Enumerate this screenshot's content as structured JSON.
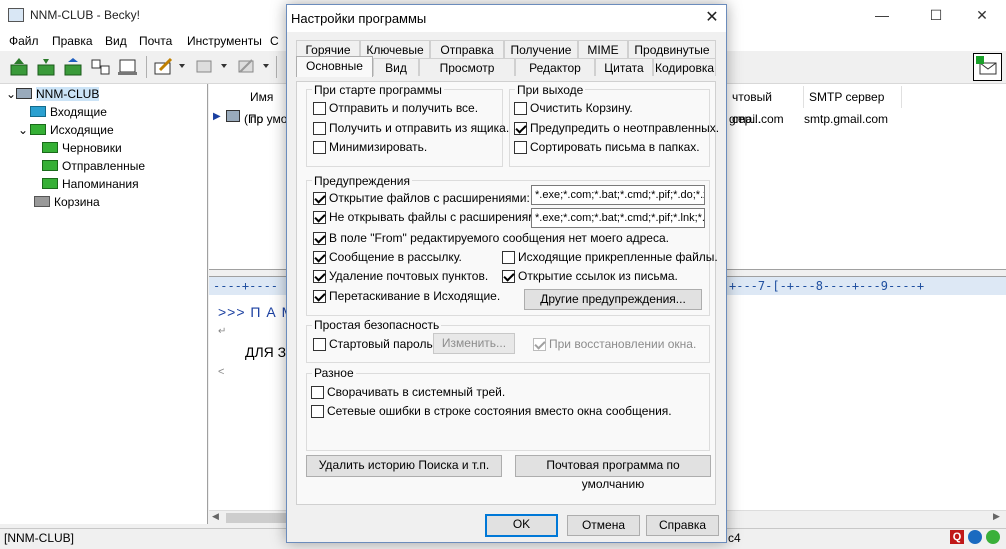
{
  "main_window": {
    "title": "NNM-CLUB - Becky!",
    "menu": [
      "Файл",
      "Правка",
      "Вид",
      "Почта",
      "Инструменты",
      "С"
    ],
    "tree": [
      {
        "label": "NNM-CLUB"
      },
      {
        "label": "Входящие"
      },
      {
        "label": "Исходящие"
      },
      {
        "label": "Черновики"
      },
      {
        "label": "Отправленные"
      },
      {
        "label": "Напоминания"
      },
      {
        "label": "Корзина"
      }
    ],
    "columns": {
      "name": "Имя пр",
      "pop": "чтовый сер...",
      "smtp": "SMTP сервер"
    },
    "row": {
      "name": "(По умо",
      "pop": "gmail.com",
      "smtp": "smtp.gmail.com"
    },
    "ruler_left": "----+----",
    "ruler_right": "+---7-[-+---8----+---9----+",
    "preview": {
      "line1": ">>> П А М",
      "line2": "↵",
      "line3": "ДЛЯ З",
      "line4": "<"
    },
    "status_left": "[NNM-CLUB]",
    "status_right": "c4"
  },
  "dialog": {
    "title": "Настройки программы",
    "tabs_row1": [
      "Горячие",
      "Ключевые",
      "Отправка",
      "Получение",
      "MIME",
      "Продвинутые"
    ],
    "tabs_row2": [
      "Основные",
      "Вид",
      "Просмотр",
      "Редактор",
      "Цитата",
      "Кодировка"
    ],
    "startup": {
      "label": "При старте программы",
      "items": [
        {
          "label": "Отправить и получить все.",
          "checked": false
        },
        {
          "label": "Получить и отправить из ящика.",
          "checked": false
        },
        {
          "label": "Минимизировать.",
          "checked": false
        }
      ]
    },
    "exit": {
      "label": "При выходе",
      "items": [
        {
          "label": "Очистить Корзину.",
          "checked": false
        },
        {
          "label": "Предупредить о неотправленных.",
          "checked": true
        },
        {
          "label": "Сортировать письма в папках.",
          "checked": false
        }
      ]
    },
    "warnings": {
      "label": "Предупреждения",
      "open_ext_label": "Открытие файлов с расширениями:",
      "open_ext_value": "*.exe;*.com;*.bat;*.cmd;*.pif;*.do;*.x",
      "noopen_ext_label": "Не открывать файлы с расширениями:",
      "noopen_ext_value": "*.exe;*.com;*.bat;*.cmd;*.pif;*.lnk;*.s",
      "from_label": "В поле \"From\" редактируемого сообщения нет моего адреса.",
      "mailing_label": "Сообщение в рассылку.",
      "outgoing_attach_label": "Исходящие прикрепленные файлы.",
      "delete_label": "Удаление почтовых пунктов.",
      "links_label": "Открытие ссылок из письма.",
      "drag_label": "Перетаскивание в Исходящие.",
      "other_button": "Другие предупреждения..."
    },
    "security": {
      "label": "Простая безопасность",
      "startup_password": "Стартовый пароль",
      "change_button": "Изменить...",
      "restore_label": "При восстановлении окна."
    },
    "misc": {
      "label": "Разное",
      "tray_label": "Сворачивать в системный трей.",
      "network_label": "Сетевые ошибки в строке состояния вместо окна сообщения."
    },
    "delete_history_button": "Удалить историю Поиска и т.п.",
    "default_mail_button": "Почтовая программа по умолчанию",
    "ok": "OK",
    "cancel": "Отмена",
    "help": "Справка"
  }
}
